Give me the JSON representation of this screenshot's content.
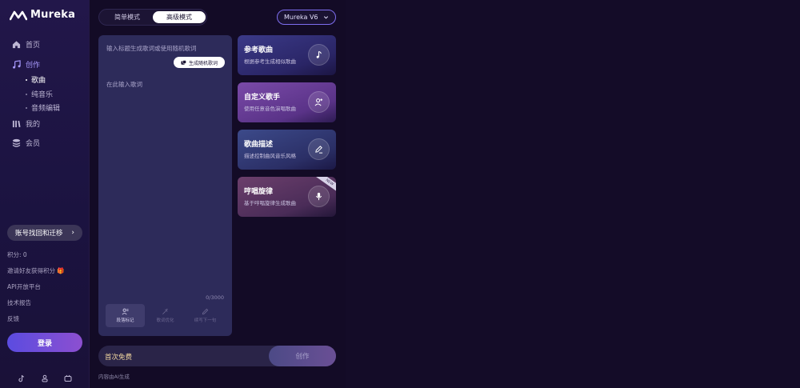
{
  "app": {
    "name": "Mureka"
  },
  "sidebar": {
    "nav": [
      {
        "label": "首页",
        "icon": "home-icon"
      },
      {
        "label": "创作",
        "icon": "music-note-icon",
        "active": true
      },
      {
        "label": "我的",
        "icon": "library-icon"
      },
      {
        "label": "会员",
        "icon": "layers-icon"
      }
    ],
    "sub": [
      {
        "label": "歌曲",
        "active": true
      },
      {
        "label": "纯音乐"
      },
      {
        "label": "音频编辑"
      }
    ],
    "account_button": "账号找回和迁移",
    "points": "积分: 0",
    "invite": "邀请好友获得积分",
    "api": "API开放平台",
    "tech_report": "技术报告",
    "feedback": "反馈",
    "login": "登录"
  },
  "header": {
    "modes": {
      "simple": "简单模式",
      "advanced": "高级模式"
    },
    "version": "Mureka V6"
  },
  "editor": {
    "title_placeholder": "输入标题生成歌词或使用随机歌词",
    "generate_lyrics": "生成随机歌词",
    "lyrics_placeholder": "在此输入歌词",
    "counter": "0/3000",
    "tools": [
      "段落标记",
      "歌词优化",
      "续写下一句"
    ]
  },
  "cards": [
    {
      "title": "参考歌曲",
      "desc": "根据参考生成相似歌曲",
      "icon": "music-note-icon"
    },
    {
      "title": "自定义歌手",
      "desc": "使用任意音色演唱歌曲",
      "icon": "add-singer-icon"
    },
    {
      "title": "歌曲描述",
      "desc": "描述控制曲风音乐风格",
      "icon": "pen-icon"
    },
    {
      "title": "哼唱旋律",
      "desc": "基于哼唱旋律生成歌曲",
      "icon": "microphone-icon",
      "badge": "NEW"
    }
  ],
  "create_bar": {
    "free": "首次免费",
    "button": "创作"
  },
  "footer": {
    "ai_note": "内容由AI生成"
  },
  "colors": {
    "accent": "#7e6ef0",
    "sidebar_bg": "#1b1340",
    "page_bg": "#130b26",
    "free_text": "#f2d7a0"
  }
}
